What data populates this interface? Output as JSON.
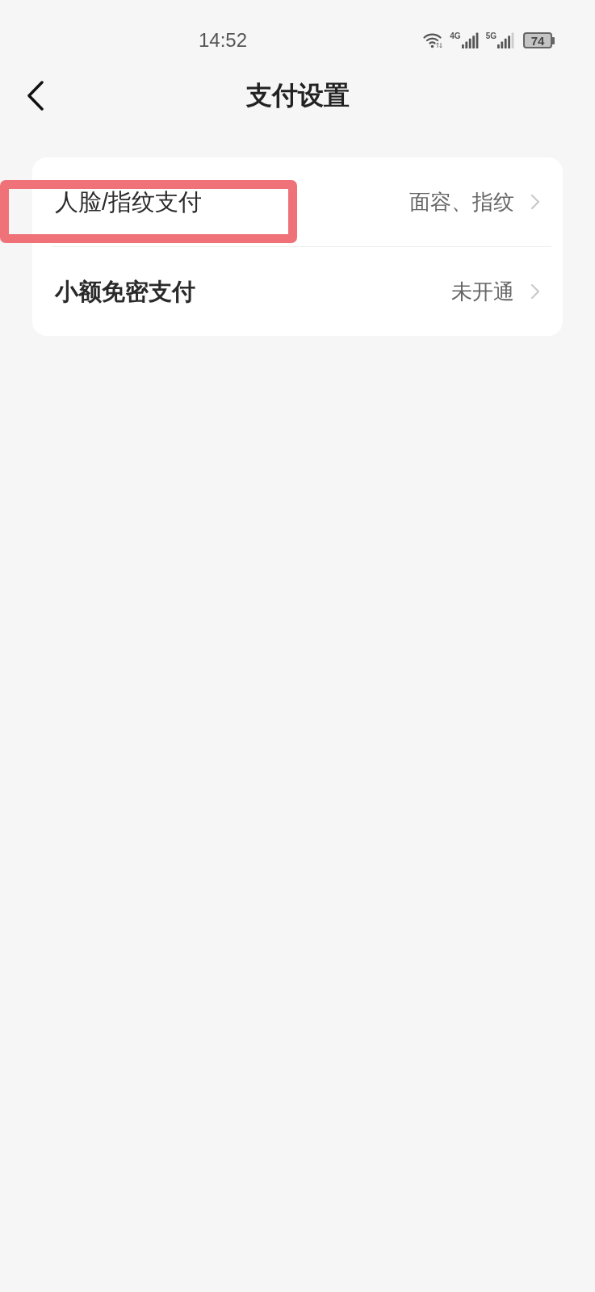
{
  "status_bar": {
    "time": "14:52",
    "network_labels": [
      "4G",
      "5G"
    ],
    "battery": "74"
  },
  "header": {
    "title": "支付设置"
  },
  "settings": [
    {
      "label": "人脸/指纹支付",
      "value": "面容、指纹",
      "bold": false,
      "highlighted": true
    },
    {
      "label": "小额免密支付",
      "value": "未开通",
      "bold": true,
      "highlighted": false
    }
  ]
}
